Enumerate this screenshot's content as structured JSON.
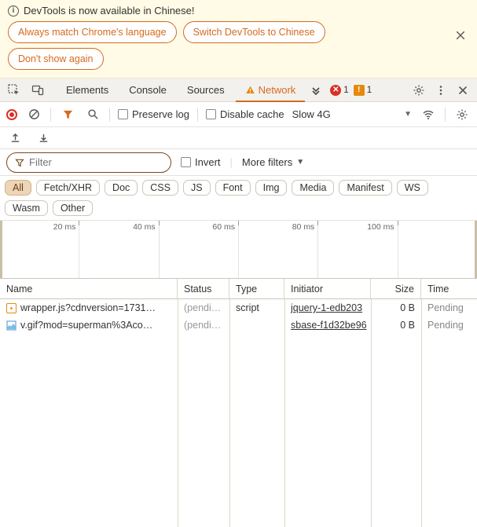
{
  "infobar": {
    "title": "DevTools is now available in Chinese!",
    "buttons": {
      "match": "Always match Chrome's language",
      "switch": "Switch DevTools to Chinese",
      "dont": "Don't show again"
    }
  },
  "tabs": {
    "elements": "Elements",
    "console": "Console",
    "sources": "Sources",
    "network": "Network"
  },
  "badges": {
    "errors": "1",
    "warnings": "1"
  },
  "toolbar": {
    "preserve_log": "Preserve log",
    "disable_cache": "Disable cache",
    "throttling": "Slow 4G"
  },
  "filter": {
    "placeholder": "Filter",
    "invert": "Invert",
    "more": "More filters"
  },
  "chips": [
    "All",
    "Fetch/XHR",
    "Doc",
    "CSS",
    "JS",
    "Font",
    "Img",
    "Media",
    "Manifest",
    "WS",
    "Wasm",
    "Other"
  ],
  "timeline": [
    "20 ms",
    "40 ms",
    "60 ms",
    "80 ms",
    "100 ms"
  ],
  "columns": {
    "name": "Name",
    "status": "Status",
    "type": "Type",
    "initiator": "Initiator",
    "size": "Size",
    "time": "Time"
  },
  "rows": [
    {
      "icon": "js",
      "name": "wrapper.js?cdnversion=1731…",
      "status": "(pendi…",
      "type": "script",
      "initiator": "jquery-1-edb203",
      "size": "0 B",
      "time": "Pending"
    },
    {
      "icon": "img",
      "name": "v.gif?mod=superman%3Aco…",
      "status": "(pendi…",
      "type": "",
      "initiator": "sbase-f1d32be96",
      "size": "0 B",
      "time": "Pending"
    }
  ]
}
